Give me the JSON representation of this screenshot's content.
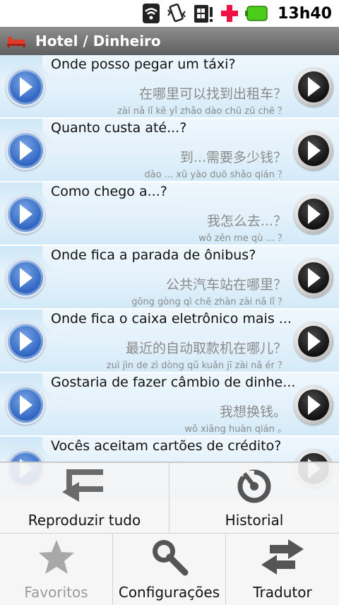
{
  "status_bar": {
    "time": "13h40",
    "battery_color": "#4ccd1c",
    "plus_color": "#ee1144"
  },
  "header": {
    "title": "Hotel / Dinheiro",
    "icon": "bed-icon"
  },
  "phrases": [
    {
      "pt": "Onde posso pegar um táxi?",
      "zh": "在哪里可以找到出租车？",
      "pinyin": "zài nǎ lǐ kě yǐ zhǎo dào chū zū chē ？"
    },
    {
      "pt": "Quanto custa até...?",
      "zh": "到...需要多少钱？",
      "pinyin": "dào ... xū yào duō shǎo qián ？"
    },
    {
      "pt": "Como chego a...?",
      "zh": "我怎么去...？",
      "pinyin": "wǒ zěn me qù ... ？"
    },
    {
      "pt": "Onde fica a parada de ônibus?",
      "zh": "公共汽车站在哪里？",
      "pinyin": "gōng gòng qì chē zhàn zài nǎ lǐ ？"
    },
    {
      "pt": "Onde fica o caixa eletrônico mais ...",
      "zh": "最近的自动取款机在哪儿？",
      "pinyin": "zuì jìn de zì dòng qǔ kuǎn jī zài nǎ ér ？"
    },
    {
      "pt": "Gostaria de fazer câmbio de dinhe...",
      "zh": "我想换钱。",
      "pinyin": "wǒ xiǎng huàn qián 。"
    },
    {
      "pt": "Vocês aceitam cartões de crédito?",
      "zh": "",
      "pinyin": ""
    }
  ],
  "menu": {
    "play_all": "Reproduzir tudo",
    "history": "Historial",
    "favorites": "Favoritos",
    "settings": "Configurações",
    "translator": "Tradutor"
  }
}
